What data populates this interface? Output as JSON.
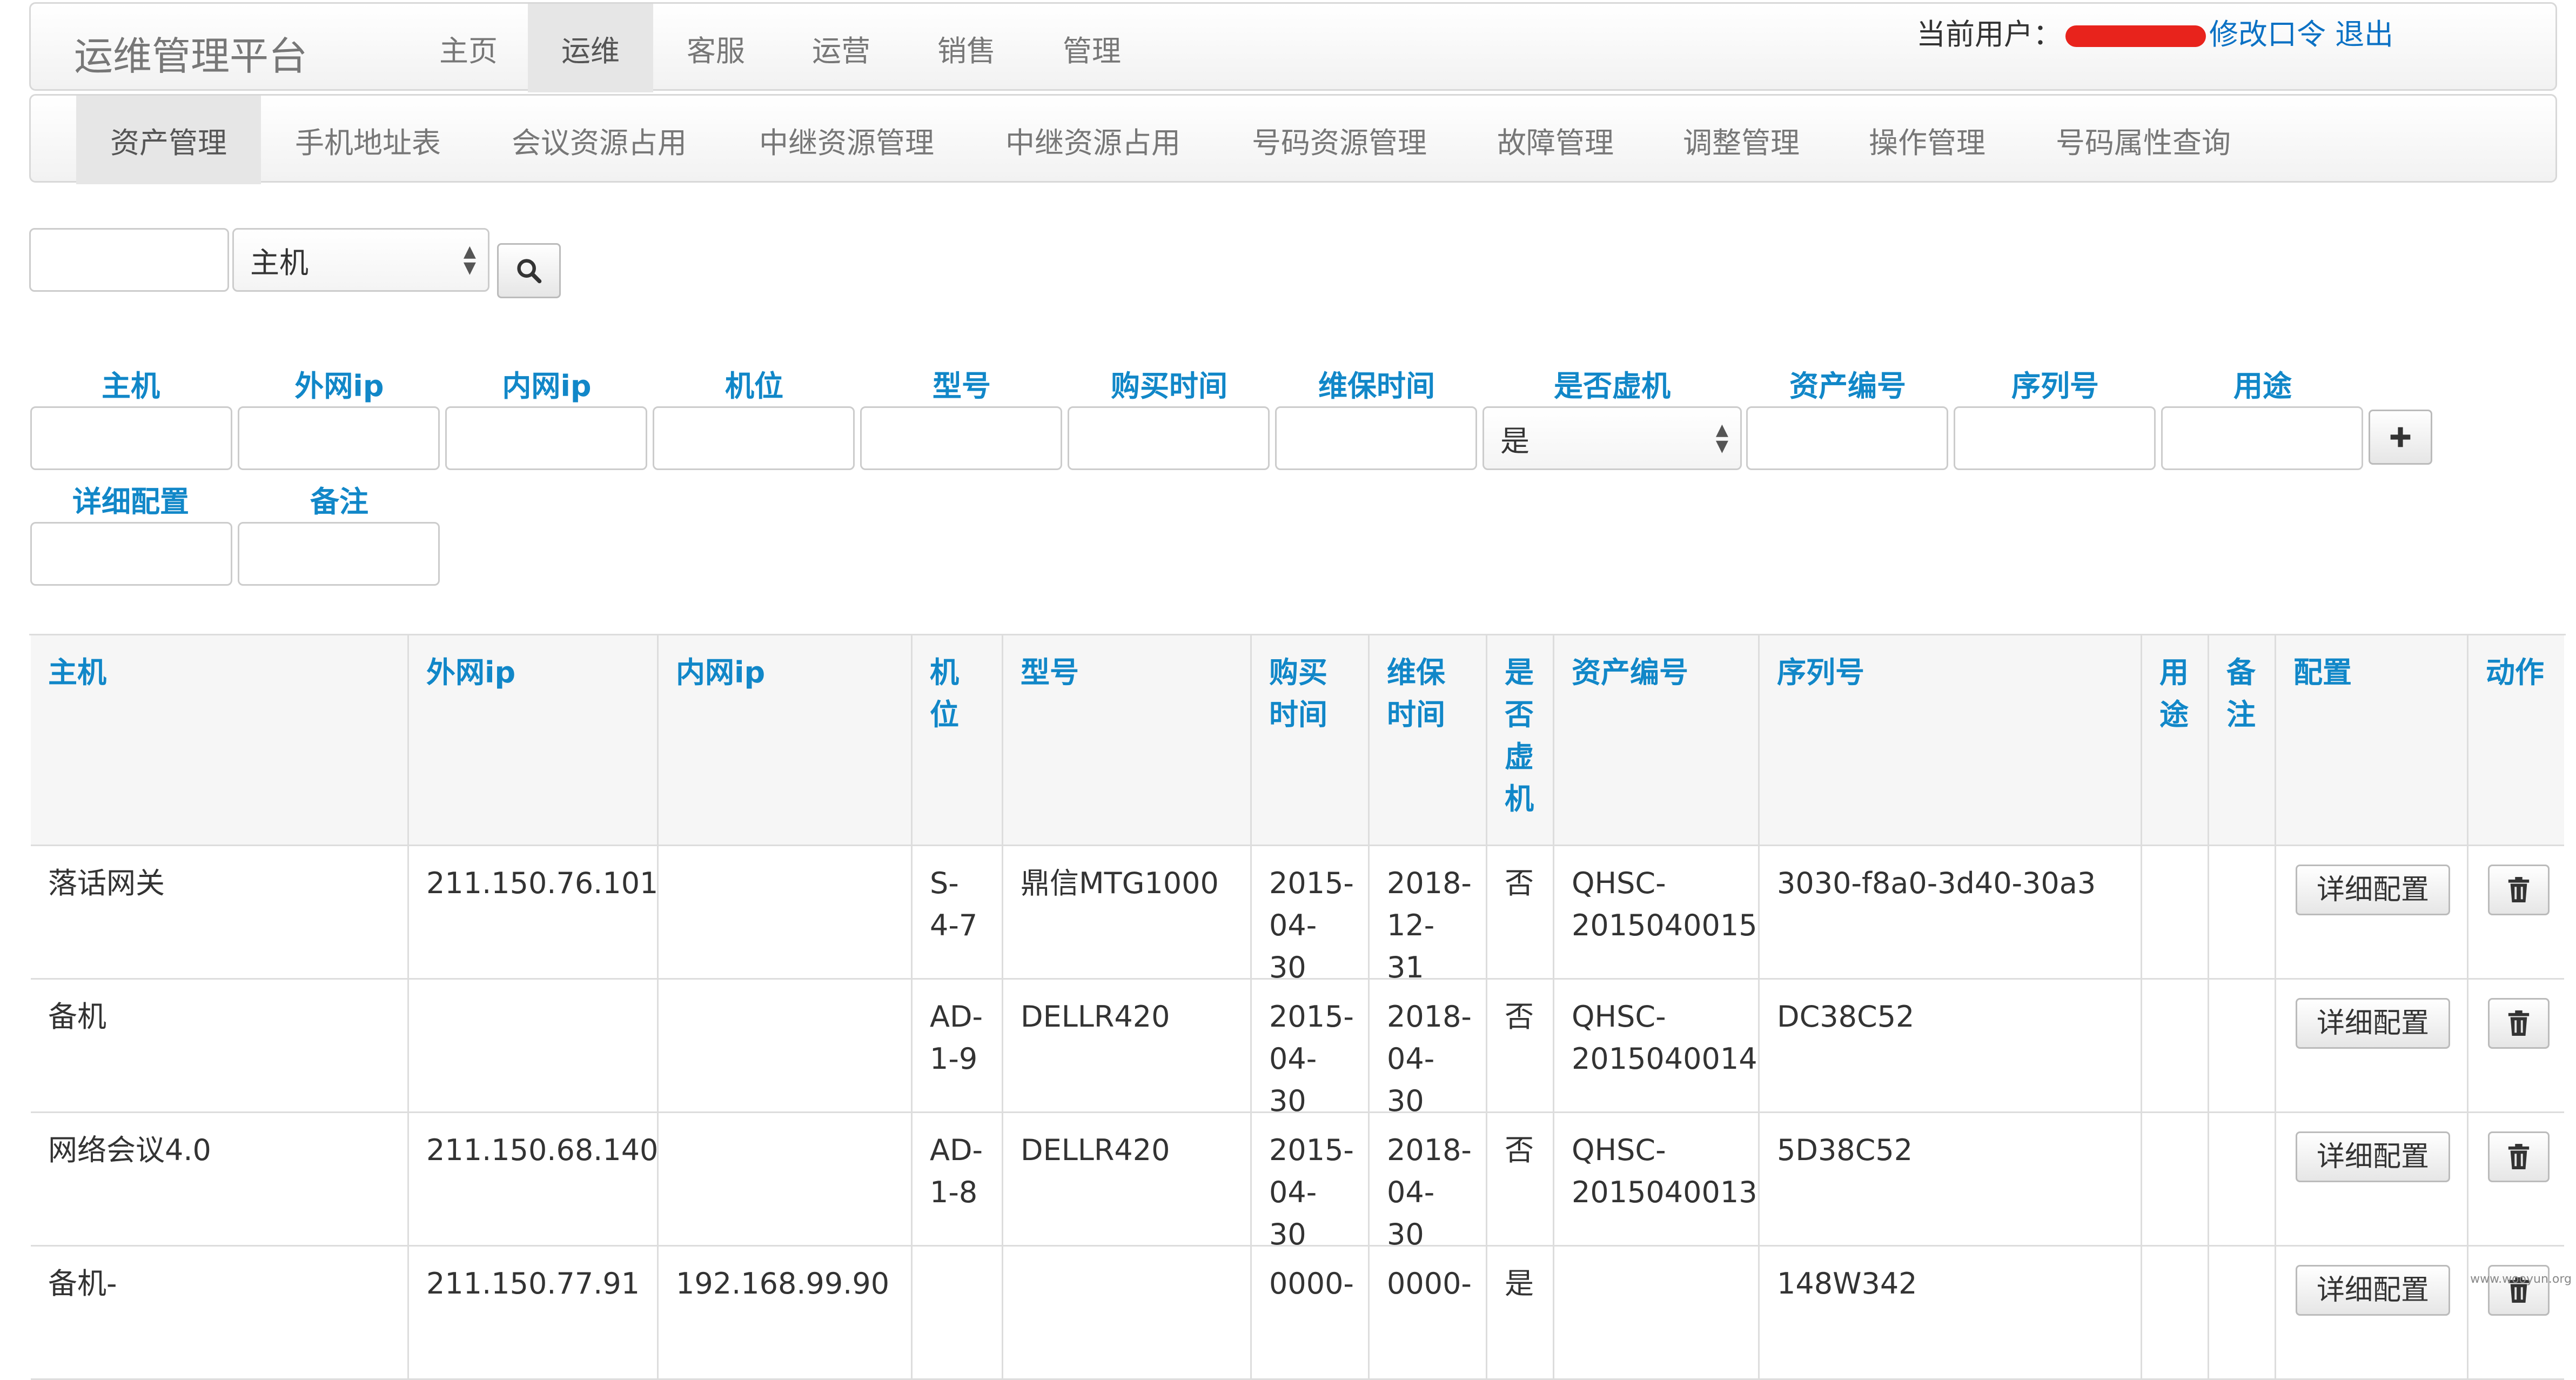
{
  "navbar": {
    "brand": "运维管理平台",
    "tabs": [
      {
        "label": "主页"
      },
      {
        "label": "运维",
        "active": true
      },
      {
        "label": "客服"
      },
      {
        "label": "运营"
      },
      {
        "label": "销售"
      },
      {
        "label": "管理"
      }
    ],
    "user_prefix": "当前用户：",
    "change_password": "修改口令",
    "logout": "退出"
  },
  "subnav": {
    "tabs": [
      {
        "label": "资产管理",
        "active": true
      },
      {
        "label": "手机地址表"
      },
      {
        "label": "会议资源占用"
      },
      {
        "label": "中继资源管理"
      },
      {
        "label": "中继资源占用"
      },
      {
        "label": "号码资源管理"
      },
      {
        "label": "故障管理"
      },
      {
        "label": "调整管理"
      },
      {
        "label": "操作管理"
      },
      {
        "label": "号码属性查询"
      }
    ]
  },
  "search": {
    "value": "",
    "field_select": "主机",
    "search_icon": "search-icon"
  },
  "add_form": {
    "labels": [
      "主机",
      "外网ip",
      "内网ip",
      "机位",
      "型号",
      "购买时间",
      "维保时间",
      "是否虚机",
      "资产编号",
      "序列号",
      "用途",
      "详细配置",
      "备注"
    ],
    "virtual_select": "是",
    "add_icon": "plus-icon"
  },
  "table": {
    "headers": [
      "主机",
      "外网ip",
      "内网ip",
      "机位",
      "型号",
      "购买时间",
      "维保时间",
      "是否虚机",
      "资产编号",
      "序列号",
      "用途",
      "备注",
      "配置",
      "动作"
    ],
    "detail_label": "详细配置",
    "delete_icon": "trash-icon",
    "rows": [
      {
        "host": "落话网关",
        "wan": "211.150.76.101",
        "lan": "",
        "pos": "S-4-7",
        "model": "鼎信MTG1000",
        "buy": "2015-04-30",
        "warranty": "2018-12-31",
        "vm": "否",
        "asset": "QHSC-2015040015",
        "serial": "3030-f8a0-3d40-30a3",
        "usage": "",
        "note": ""
      },
      {
        "host": "备机",
        "wan": "",
        "lan": "",
        "pos": "AD-1-9",
        "model": "DELLR420",
        "buy": "2015-04-30",
        "warranty": "2018-04-30",
        "vm": "否",
        "asset": "QHSC-2015040014",
        "serial": "DC38C52",
        "usage": "",
        "note": ""
      },
      {
        "host": "网络会议4.0",
        "wan": "211.150.68.140",
        "lan": "",
        "pos": "AD-1-8",
        "model": "DELLR420",
        "buy": "2015-04-30",
        "warranty": "2018-04-30",
        "vm": "否",
        "asset": "QHSC-2015040013",
        "serial": "5D38C52",
        "usage": "",
        "note": ""
      },
      {
        "host": "备机-",
        "wan": "211.150.77.91",
        "lan": "192.168.99.90",
        "pos": "",
        "model": "",
        "buy": "0000-",
        "warranty": "0000-",
        "vm": "是",
        "asset": "",
        "serial": "148W342",
        "usage": "",
        "note": ""
      }
    ]
  },
  "colors": {
    "link": "#1187c8",
    "accent_link": "#0b71c4",
    "redaction": "#e8231c"
  },
  "watermark": "www.wooyun.org"
}
